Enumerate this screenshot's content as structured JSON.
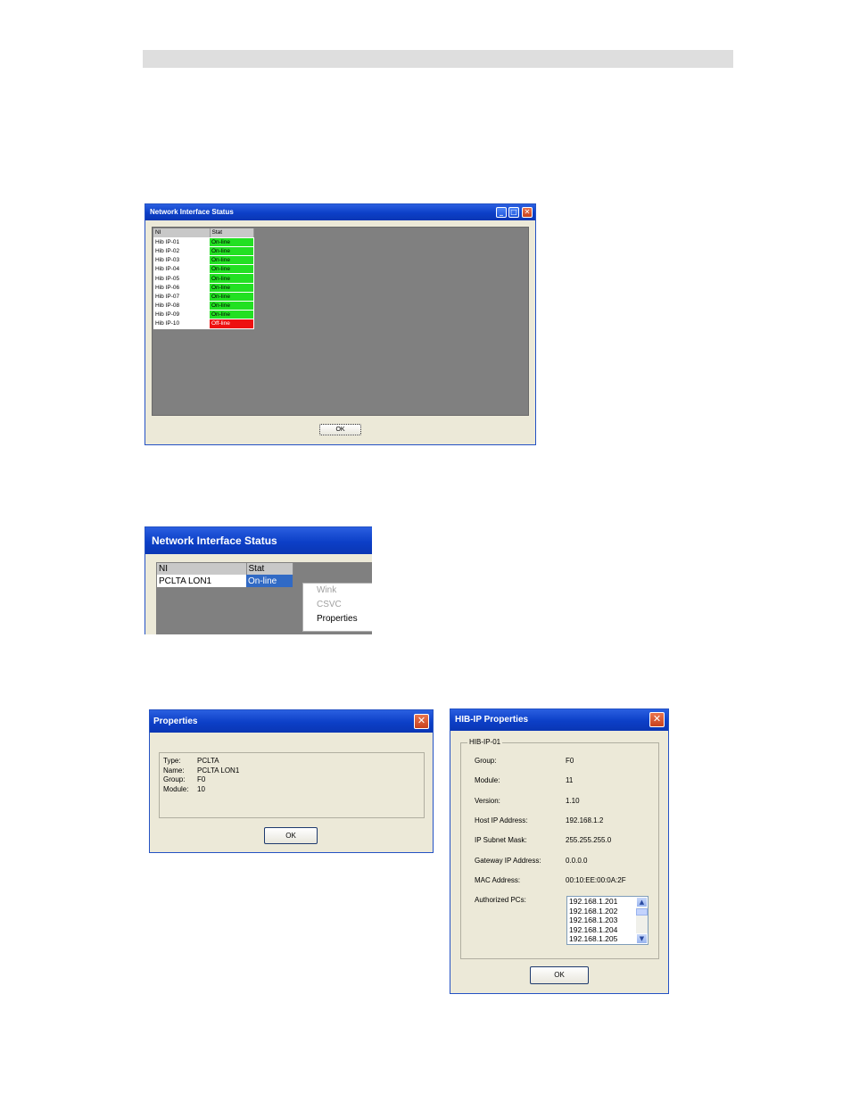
{
  "window1": {
    "title": "Network Interface Status",
    "columns": [
      "NI",
      "Stat"
    ],
    "rows": [
      {
        "ni": "Hib IP-01",
        "stat": "On-line",
        "status": "on"
      },
      {
        "ni": "Hib IP-02",
        "stat": "On-line",
        "status": "on"
      },
      {
        "ni": "Hib IP-03",
        "stat": "On-line",
        "status": "on"
      },
      {
        "ni": "Hib IP-04",
        "stat": "On-line",
        "status": "on"
      },
      {
        "ni": "Hib IP-05",
        "stat": "On-line",
        "status": "on"
      },
      {
        "ni": "Hib IP-06",
        "stat": "On-line",
        "status": "on"
      },
      {
        "ni": "Hib IP-07",
        "stat": "On-line",
        "status": "on"
      },
      {
        "ni": "Hib IP-08",
        "stat": "On-line",
        "status": "on"
      },
      {
        "ni": "Hib IP-09",
        "stat": "On-line",
        "status": "on"
      },
      {
        "ni": "Hib IP-10",
        "stat": "Off-line",
        "status": "off"
      }
    ],
    "ok_label": "OK",
    "status_colors": {
      "on": "#22e022",
      "off": "#ee1111"
    }
  },
  "window2": {
    "title": "Network Interface Status",
    "columns": [
      "NI",
      "Stat"
    ],
    "row": {
      "ni": "PCLTA LON1",
      "stat": "On-line"
    },
    "context_menu": [
      {
        "label": "Wink",
        "enabled": false
      },
      {
        "label": "CSVC",
        "enabled": false
      },
      {
        "label": "Properties",
        "enabled": true
      }
    ]
  },
  "window3": {
    "title": "Properties",
    "fields": [
      {
        "label": "Type:",
        "value": "PCLTA"
      },
      {
        "label": "Name:",
        "value": "PCLTA LON1"
      },
      {
        "label": "Group:",
        "value": "F0"
      },
      {
        "label": "Module:",
        "value": "10"
      }
    ],
    "ok_label": "OK"
  },
  "window4": {
    "title": "HIB-IP Properties",
    "group_title": "HIB-IP-01",
    "fields": [
      {
        "label": "Group:",
        "value": "F0"
      },
      {
        "label": "Module:",
        "value": "11"
      },
      {
        "label": "Version:",
        "value": "1.10"
      },
      {
        "label": "Host IP Address:",
        "value": "192.168.1.2"
      },
      {
        "label": "IP Subnet Mask:",
        "value": "255.255.255.0"
      },
      {
        "label": "Gateway IP Address:",
        "value": "0.0.0.0"
      },
      {
        "label": "MAC Address:",
        "value": "00:10:EE:00:0A:2F"
      }
    ],
    "authorized_label": "Authorized PCs:",
    "authorized_pcs": [
      "192.168.1.201",
      "192.168.1.202",
      "192.168.1.203",
      "192.168.1.204",
      "192.168.1.205"
    ],
    "ok_label": "OK"
  },
  "icons": {
    "minimize": "_",
    "maximize": "□",
    "close": "✕",
    "scroll_up": "▲",
    "scroll_down": "▼"
  }
}
